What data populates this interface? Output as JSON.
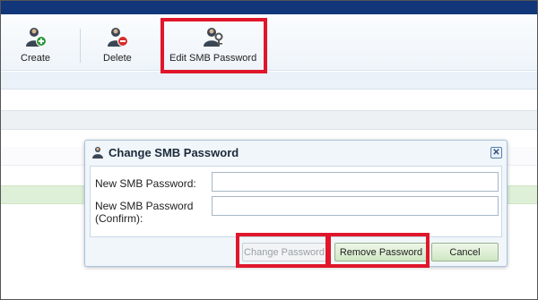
{
  "toolbar": {
    "buttons": [
      {
        "label": "Create",
        "icon": "user-add-icon"
      },
      {
        "label": "Delete",
        "icon": "user-delete-icon"
      },
      {
        "label": "Edit SMB Password",
        "icon": "user-key-icon"
      }
    ]
  },
  "dialog": {
    "title": "Change SMB Password",
    "title_icon": "user-icon",
    "close_glyph": "✕",
    "fields": [
      {
        "label": "New SMB Password:",
        "value": ""
      },
      {
        "label": "New SMB Password (Confirm):",
        "value": ""
      }
    ],
    "buttons": {
      "change_password": "Change Password",
      "remove_password": "Remove Password",
      "cancel": "Cancel"
    }
  },
  "colors": {
    "header_bar": "#12367a",
    "highlight": "#e0162b",
    "button_green": "#cfe7c3"
  }
}
